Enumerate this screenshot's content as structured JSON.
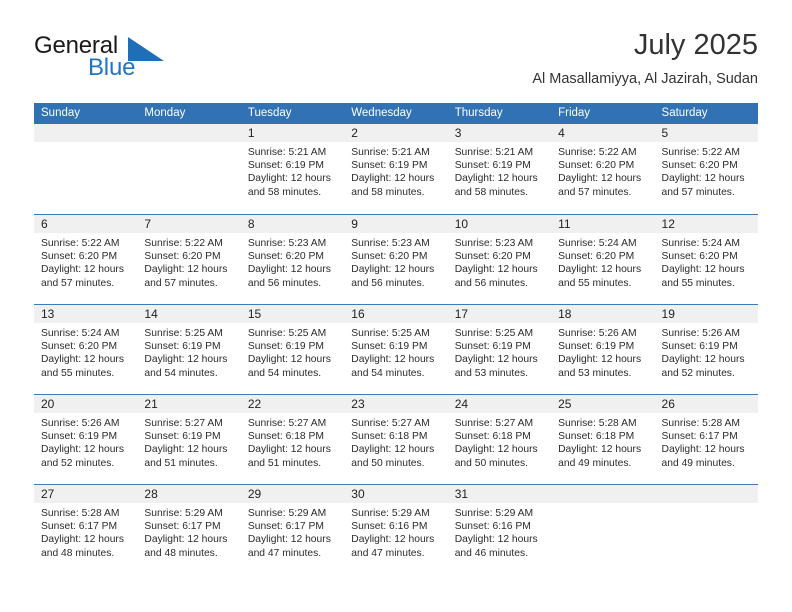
{
  "brand": {
    "name_part1": "General",
    "name_part2": "Blue",
    "accent_color": "#2175c4"
  },
  "header": {
    "title": "July 2025",
    "subtitle": "Al Masallamiyya, Al Jazirah, Sudan"
  },
  "calendar": {
    "header_color": "#3072b3",
    "weekdays": [
      "Sunday",
      "Monday",
      "Tuesday",
      "Wednesday",
      "Thursday",
      "Friday",
      "Saturday"
    ],
    "weeks": [
      [
        {
          "day": "",
          "sunrise": "",
          "sunset": "",
          "daylight_line1": "",
          "daylight_line2": ""
        },
        {
          "day": "",
          "sunrise": "",
          "sunset": "",
          "daylight_line1": "",
          "daylight_line2": ""
        },
        {
          "day": "1",
          "sunrise": "Sunrise: 5:21 AM",
          "sunset": "Sunset: 6:19 PM",
          "daylight_line1": "Daylight: 12 hours",
          "daylight_line2": "and 58 minutes."
        },
        {
          "day": "2",
          "sunrise": "Sunrise: 5:21 AM",
          "sunset": "Sunset: 6:19 PM",
          "daylight_line1": "Daylight: 12 hours",
          "daylight_line2": "and 58 minutes."
        },
        {
          "day": "3",
          "sunrise": "Sunrise: 5:21 AM",
          "sunset": "Sunset: 6:19 PM",
          "daylight_line1": "Daylight: 12 hours",
          "daylight_line2": "and 58 minutes."
        },
        {
          "day": "4",
          "sunrise": "Sunrise: 5:22 AM",
          "sunset": "Sunset: 6:20 PM",
          "daylight_line1": "Daylight: 12 hours",
          "daylight_line2": "and 57 minutes."
        },
        {
          "day": "5",
          "sunrise": "Sunrise: 5:22 AM",
          "sunset": "Sunset: 6:20 PM",
          "daylight_line1": "Daylight: 12 hours",
          "daylight_line2": "and 57 minutes."
        }
      ],
      [
        {
          "day": "6",
          "sunrise": "Sunrise: 5:22 AM",
          "sunset": "Sunset: 6:20 PM",
          "daylight_line1": "Daylight: 12 hours",
          "daylight_line2": "and 57 minutes."
        },
        {
          "day": "7",
          "sunrise": "Sunrise: 5:22 AM",
          "sunset": "Sunset: 6:20 PM",
          "daylight_line1": "Daylight: 12 hours",
          "daylight_line2": "and 57 minutes."
        },
        {
          "day": "8",
          "sunrise": "Sunrise: 5:23 AM",
          "sunset": "Sunset: 6:20 PM",
          "daylight_line1": "Daylight: 12 hours",
          "daylight_line2": "and 56 minutes."
        },
        {
          "day": "9",
          "sunrise": "Sunrise: 5:23 AM",
          "sunset": "Sunset: 6:20 PM",
          "daylight_line1": "Daylight: 12 hours",
          "daylight_line2": "and 56 minutes."
        },
        {
          "day": "10",
          "sunrise": "Sunrise: 5:23 AM",
          "sunset": "Sunset: 6:20 PM",
          "daylight_line1": "Daylight: 12 hours",
          "daylight_line2": "and 56 minutes."
        },
        {
          "day": "11",
          "sunrise": "Sunrise: 5:24 AM",
          "sunset": "Sunset: 6:20 PM",
          "daylight_line1": "Daylight: 12 hours",
          "daylight_line2": "and 55 minutes."
        },
        {
          "day": "12",
          "sunrise": "Sunrise: 5:24 AM",
          "sunset": "Sunset: 6:20 PM",
          "daylight_line1": "Daylight: 12 hours",
          "daylight_line2": "and 55 minutes."
        }
      ],
      [
        {
          "day": "13",
          "sunrise": "Sunrise: 5:24 AM",
          "sunset": "Sunset: 6:20 PM",
          "daylight_line1": "Daylight: 12 hours",
          "daylight_line2": "and 55 minutes."
        },
        {
          "day": "14",
          "sunrise": "Sunrise: 5:25 AM",
          "sunset": "Sunset: 6:19 PM",
          "daylight_line1": "Daylight: 12 hours",
          "daylight_line2": "and 54 minutes."
        },
        {
          "day": "15",
          "sunrise": "Sunrise: 5:25 AM",
          "sunset": "Sunset: 6:19 PM",
          "daylight_line1": "Daylight: 12 hours",
          "daylight_line2": "and 54 minutes."
        },
        {
          "day": "16",
          "sunrise": "Sunrise: 5:25 AM",
          "sunset": "Sunset: 6:19 PM",
          "daylight_line1": "Daylight: 12 hours",
          "daylight_line2": "and 54 minutes."
        },
        {
          "day": "17",
          "sunrise": "Sunrise: 5:25 AM",
          "sunset": "Sunset: 6:19 PM",
          "daylight_line1": "Daylight: 12 hours",
          "daylight_line2": "and 53 minutes."
        },
        {
          "day": "18",
          "sunrise": "Sunrise: 5:26 AM",
          "sunset": "Sunset: 6:19 PM",
          "daylight_line1": "Daylight: 12 hours",
          "daylight_line2": "and 53 minutes."
        },
        {
          "day": "19",
          "sunrise": "Sunrise: 5:26 AM",
          "sunset": "Sunset: 6:19 PM",
          "daylight_line1": "Daylight: 12 hours",
          "daylight_line2": "and 52 minutes."
        }
      ],
      [
        {
          "day": "20",
          "sunrise": "Sunrise: 5:26 AM",
          "sunset": "Sunset: 6:19 PM",
          "daylight_line1": "Daylight: 12 hours",
          "daylight_line2": "and 52 minutes."
        },
        {
          "day": "21",
          "sunrise": "Sunrise: 5:27 AM",
          "sunset": "Sunset: 6:19 PM",
          "daylight_line1": "Daylight: 12 hours",
          "daylight_line2": "and 51 minutes."
        },
        {
          "day": "22",
          "sunrise": "Sunrise: 5:27 AM",
          "sunset": "Sunset: 6:18 PM",
          "daylight_line1": "Daylight: 12 hours",
          "daylight_line2": "and 51 minutes."
        },
        {
          "day": "23",
          "sunrise": "Sunrise: 5:27 AM",
          "sunset": "Sunset: 6:18 PM",
          "daylight_line1": "Daylight: 12 hours",
          "daylight_line2": "and 50 minutes."
        },
        {
          "day": "24",
          "sunrise": "Sunrise: 5:27 AM",
          "sunset": "Sunset: 6:18 PM",
          "daylight_line1": "Daylight: 12 hours",
          "daylight_line2": "and 50 minutes."
        },
        {
          "day": "25",
          "sunrise": "Sunrise: 5:28 AM",
          "sunset": "Sunset: 6:18 PM",
          "daylight_line1": "Daylight: 12 hours",
          "daylight_line2": "and 49 minutes."
        },
        {
          "day": "26",
          "sunrise": "Sunrise: 5:28 AM",
          "sunset": "Sunset: 6:17 PM",
          "daylight_line1": "Daylight: 12 hours",
          "daylight_line2": "and 49 minutes."
        }
      ],
      [
        {
          "day": "27",
          "sunrise": "Sunrise: 5:28 AM",
          "sunset": "Sunset: 6:17 PM",
          "daylight_line1": "Daylight: 12 hours",
          "daylight_line2": "and 48 minutes."
        },
        {
          "day": "28",
          "sunrise": "Sunrise: 5:29 AM",
          "sunset": "Sunset: 6:17 PM",
          "daylight_line1": "Daylight: 12 hours",
          "daylight_line2": "and 48 minutes."
        },
        {
          "day": "29",
          "sunrise": "Sunrise: 5:29 AM",
          "sunset": "Sunset: 6:17 PM",
          "daylight_line1": "Daylight: 12 hours",
          "daylight_line2": "and 47 minutes."
        },
        {
          "day": "30",
          "sunrise": "Sunrise: 5:29 AM",
          "sunset": "Sunset: 6:16 PM",
          "daylight_line1": "Daylight: 12 hours",
          "daylight_line2": "and 47 minutes."
        },
        {
          "day": "31",
          "sunrise": "Sunrise: 5:29 AM",
          "sunset": "Sunset: 6:16 PM",
          "daylight_line1": "Daylight: 12 hours",
          "daylight_line2": "and 46 minutes."
        },
        {
          "day": "",
          "sunrise": "",
          "sunset": "",
          "daylight_line1": "",
          "daylight_line2": ""
        },
        {
          "day": "",
          "sunrise": "",
          "sunset": "",
          "daylight_line1": "",
          "daylight_line2": ""
        }
      ]
    ]
  }
}
